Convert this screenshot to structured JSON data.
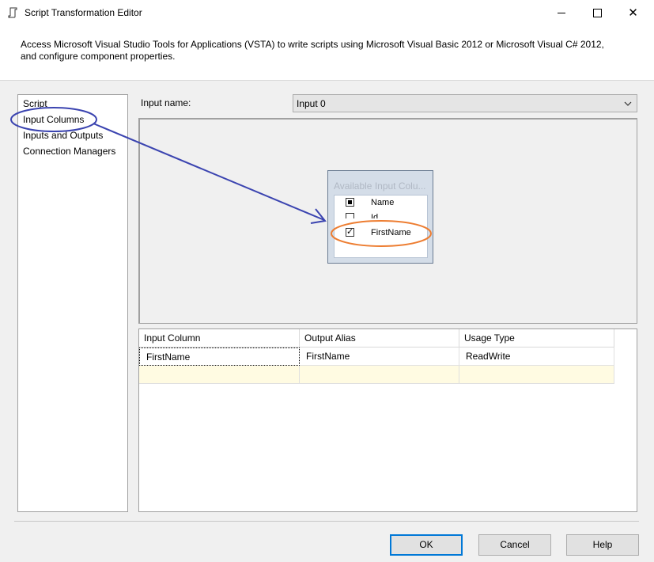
{
  "window": {
    "title": "Script Transformation Editor",
    "controls": {
      "minimize": "minimize",
      "maximize": "maximize",
      "close": "✕"
    }
  },
  "description": "Access Microsoft Visual Studio Tools for Applications (VSTA) to write scripts using Microsoft Visual Basic 2012 or Microsoft Visual C# 2012, and configure component properties.",
  "nav": {
    "items": [
      {
        "label": "Script"
      },
      {
        "label": "Input Columns"
      },
      {
        "label": "Inputs and Outputs"
      },
      {
        "label": "Connection Managers"
      }
    ],
    "selected": "Input Columns"
  },
  "input": {
    "label": "Input name:",
    "value": "Input 0"
  },
  "available_columns": {
    "title": "Available Input Colu...",
    "rows": [
      {
        "label": "Name",
        "state": "indeterminate"
      },
      {
        "label": "Id",
        "state": "unchecked"
      },
      {
        "label": "FirstName",
        "state": "checked"
      }
    ]
  },
  "grid": {
    "headers": [
      "Input Column",
      "Output Alias",
      "Usage Type"
    ],
    "rows": [
      {
        "input_column": "FirstName",
        "output_alias": "FirstName",
        "usage_type": "ReadWrite"
      }
    ]
  },
  "buttons": {
    "ok": "OK",
    "cancel": "Cancel",
    "help": "Help"
  },
  "annotation_colors": {
    "callout_circle": "#3b44b0",
    "highlight_circle": "#ed7d31"
  }
}
